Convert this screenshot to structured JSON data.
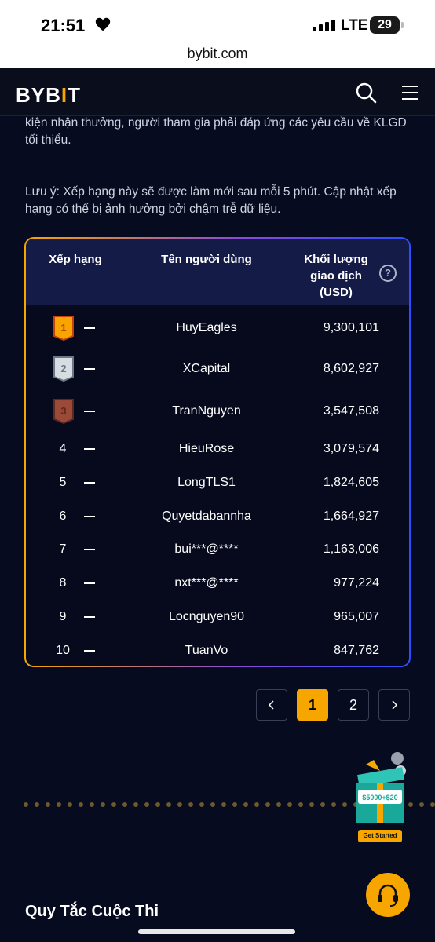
{
  "status_bar": {
    "time": "21:51",
    "network": "LTE",
    "battery": "29"
  },
  "browser": {
    "url": "bybit.com"
  },
  "nav": {
    "logo": "BYB",
    "logo_bar": "I",
    "logo_end": "T"
  },
  "intro_text": "kiện nhận thưởng, người tham gia phải đáp ứng các yêu cầu về KLGD tối thiểu.",
  "note_text": "Lưu ý: Xếp hạng này sẽ được làm mới sau mỗi 5 phút. Cập nhật xếp hạng có thể bị ảnh hưởng bởi chậm trễ dữ liệu.",
  "table": {
    "headers": {
      "rank": "Xếp hạng",
      "user": "Tên người dùng",
      "volume_l1": "Khối lượng",
      "volume_l2": "giao dịch",
      "volume_l3": "(USD)"
    },
    "help_icon": "?",
    "rows": [
      {
        "rank": "1",
        "medal": "gold",
        "change": "—",
        "user": "HuyEagles",
        "volume": "9,300,101"
      },
      {
        "rank": "2",
        "medal": "silver",
        "change": "—",
        "user": "XCapital",
        "volume": "8,602,927"
      },
      {
        "rank": "3",
        "medal": "bronze",
        "change": "—",
        "user": "TranNguyen",
        "volume": "3,547,508"
      },
      {
        "rank": "4",
        "change": "—",
        "user": "HieuRose",
        "volume": "3,079,574"
      },
      {
        "rank": "5",
        "change": "—",
        "user": "LongTLS1",
        "volume": "1,824,605"
      },
      {
        "rank": "6",
        "change": "—",
        "user": "Quyetdabannha",
        "volume": "1,664,927"
      },
      {
        "rank": "7",
        "change": "—",
        "user": "bui***@****",
        "volume": "1,163,006"
      },
      {
        "rank": "8",
        "change": "—",
        "user": "nxt***@****",
        "volume": "977,224"
      },
      {
        "rank": "9",
        "change": "—",
        "user": "Locnguyen90",
        "volume": "965,007"
      },
      {
        "rank": "10",
        "change": "—",
        "user": "TuanVo",
        "volume": "847,762"
      }
    ]
  },
  "pagination": {
    "pages": [
      "1",
      "2"
    ],
    "current": "1"
  },
  "promo": {
    "amount": "$5000+$20",
    "cta": "Get Started"
  },
  "rules_title": "Quy Tắc Cuộc Thi",
  "colors": {
    "accent": "#f7a600",
    "background": "#070b1f",
    "header_bg": "#141b47"
  }
}
